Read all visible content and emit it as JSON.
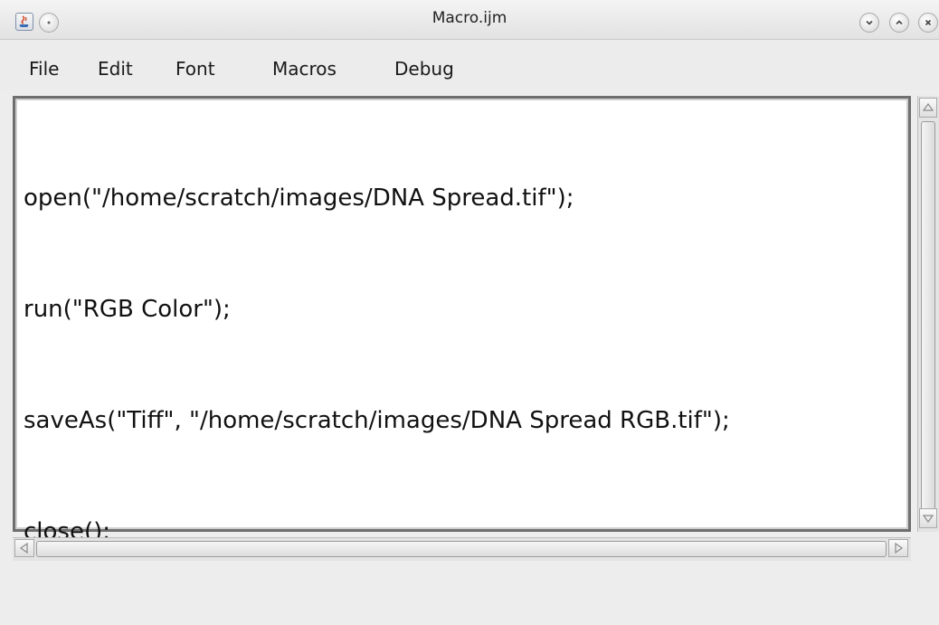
{
  "window": {
    "title": "Macro.ijm",
    "app_icon": "java-icon",
    "controls": [
      "minimize-icon",
      "maximize-icon",
      "close-icon"
    ]
  },
  "menubar": {
    "items": [
      "File",
      "Edit",
      "Font",
      "Macros",
      "Debug"
    ]
  },
  "editor": {
    "lines": [
      "open(\"/home/scratch/images/DNA Spread.tif\");",
      "run(\"RGB Color\");",
      "saveAs(\"Tiff\", \"/home/scratch/images/DNA Spread RGB.tif\");",
      "close();"
    ]
  },
  "colors": {
    "titlebar": "#e9e9e9",
    "editor_bg": "#ffffff",
    "text": "#111111"
  }
}
